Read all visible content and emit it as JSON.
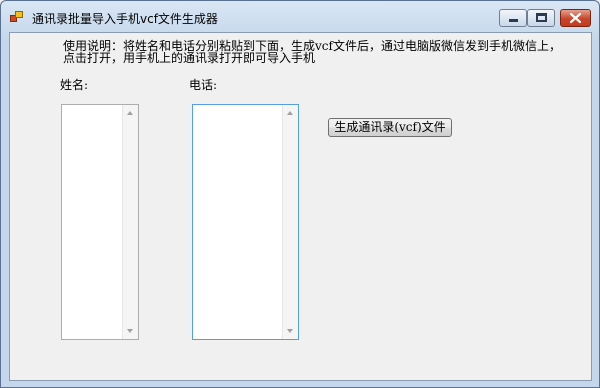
{
  "window": {
    "title": "通讯录批量导入手机vcf文件生成器",
    "icon": "app-icon"
  },
  "instructions": {
    "line1": "使用说明：将姓名和电话分别粘贴到下面，生成vcf文件后，通过电脑版微信发到手机微信上，",
    "line2": "点击打开，用手机上的通讯录打开即可导入手机"
  },
  "form": {
    "name_label": "姓名:",
    "phone_label": "电话:",
    "names_value": "",
    "phones_value": "",
    "generate_button_label": "生成通讯录(vcf)文件"
  }
}
